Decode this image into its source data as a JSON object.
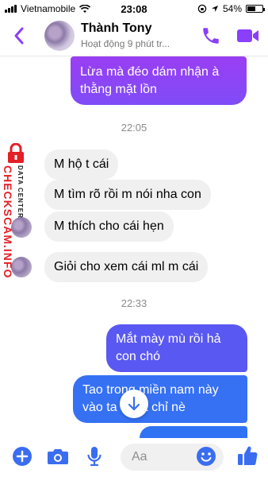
{
  "status_bar": {
    "carrier": "Vietnamobile",
    "time": "23:08",
    "battery": "54%",
    "battery_level": 0.54
  },
  "header": {
    "name": "Thành Tony",
    "status": "Hoạt động 9 phút tr..."
  },
  "colors": {
    "accent": "#8a3ffc",
    "out_top": "#8d45f5",
    "out_bottom": "#2f72f3",
    "incoming": "#f0f0f0"
  },
  "messages": {
    "m0": "Lừa mà đéo dám nhận à thằng mặt lồn",
    "t1": "22:05",
    "m1": "M hộ t cái",
    "m2": "M tìm rõ rồi m nói nha con",
    "m3": "M thích cho cái hẹn",
    "m4": "Giỏi cho xem cái ml m cái",
    "t2": "22:33",
    "m5": "Mắt mày mù rồi hả con chó",
    "m6": "Tao trong miền nam này vào ta  o địa chỉ nè"
  },
  "watermark": {
    "main": "CHECKSCAM.INFO",
    "sub": "DATA CENTER"
  },
  "composer": {
    "placeholder": "Aa"
  },
  "icons": [
    "back-icon",
    "phone-icon",
    "video-icon",
    "plus-icon",
    "camera-icon",
    "microphone-icon",
    "emoji-icon",
    "thumbs-up-icon",
    "lock-icon",
    "arrow-down-icon"
  ]
}
